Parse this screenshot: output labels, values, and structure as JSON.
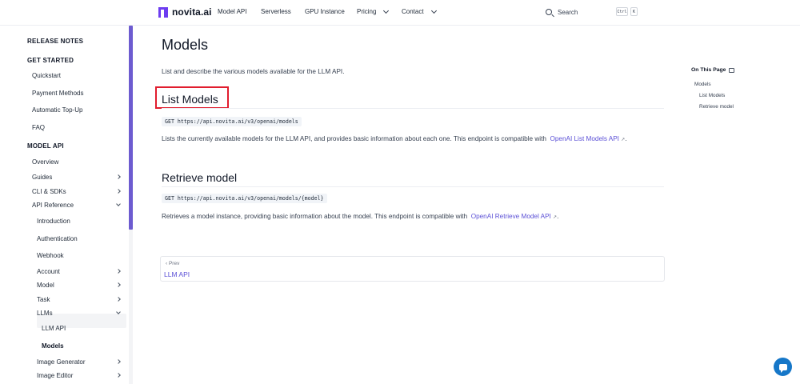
{
  "header": {
    "logo_text": "novita.ai",
    "nav": [
      {
        "label": "Model API",
        "dropdown": false
      },
      {
        "label": "Serverless",
        "dropdown": false
      },
      {
        "label": "GPU Instance",
        "dropdown": false
      },
      {
        "label": "Pricing",
        "dropdown": true
      },
      {
        "label": "Contact",
        "dropdown": true
      }
    ],
    "search_label": "Search",
    "kbd_ctrl": "Ctrl",
    "kbd_k": "K"
  },
  "sidebar": {
    "items": [
      {
        "label": "RELEASE NOTES"
      },
      {
        "label": "GET STARTED"
      },
      {
        "label": "Quickstart"
      },
      {
        "label": "Payment Methods"
      },
      {
        "label": "Automatic Top-Up"
      },
      {
        "label": "FAQ"
      },
      {
        "label": "MODEL API"
      },
      {
        "label": "Overview"
      },
      {
        "label": "Guides"
      },
      {
        "label": "CLI & SDKs"
      },
      {
        "label": "API Reference"
      },
      {
        "label": "Introduction"
      },
      {
        "label": "Authentication"
      },
      {
        "label": "Webhook"
      },
      {
        "label": "Account"
      },
      {
        "label": "Model"
      },
      {
        "label": "Task"
      },
      {
        "label": "LLMs"
      },
      {
        "label": "LLM API"
      },
      {
        "label": "Models"
      },
      {
        "label": "Image Generator"
      },
      {
        "label": "Image Editor"
      }
    ]
  },
  "main": {
    "title": "Models",
    "intro": "List and describe the various models available for the LLM API.",
    "list_models": {
      "heading": "List Models",
      "endpoint": "GET https://api.novita.ai/v3/openai/models",
      "description": "Lists the currently available models for the LLM API, and provides basic information about each one. This endpoint is compatible with",
      "link_text": "OpenAI List Models API",
      "trailing": "."
    },
    "retrieve_model": {
      "heading": "Retrieve model",
      "endpoint": "GET https://api.novita.ai/v3/openai/models/{model}",
      "description": "Retrieves a model instance, providing basic information about the model. This endpoint is compatible with",
      "link_text": "OpenAI Retrieve Model API",
      "trailing": "."
    },
    "pager": {
      "prev_label": "‹ Prev",
      "prev_title": "LLM API"
    }
  },
  "toc": {
    "title": "On This Page",
    "items": [
      "Models",
      "List Models",
      "Retrieve model"
    ]
  },
  "icons": {
    "external_link": "↗",
    "print": "print-icon",
    "chat": "chat-icon"
  },
  "colors": {
    "accent": "#5b50d6",
    "scroll_thumb": "#6d5bd0",
    "highlight": "#e11d2e",
    "chat_button": "#1677c8"
  }
}
